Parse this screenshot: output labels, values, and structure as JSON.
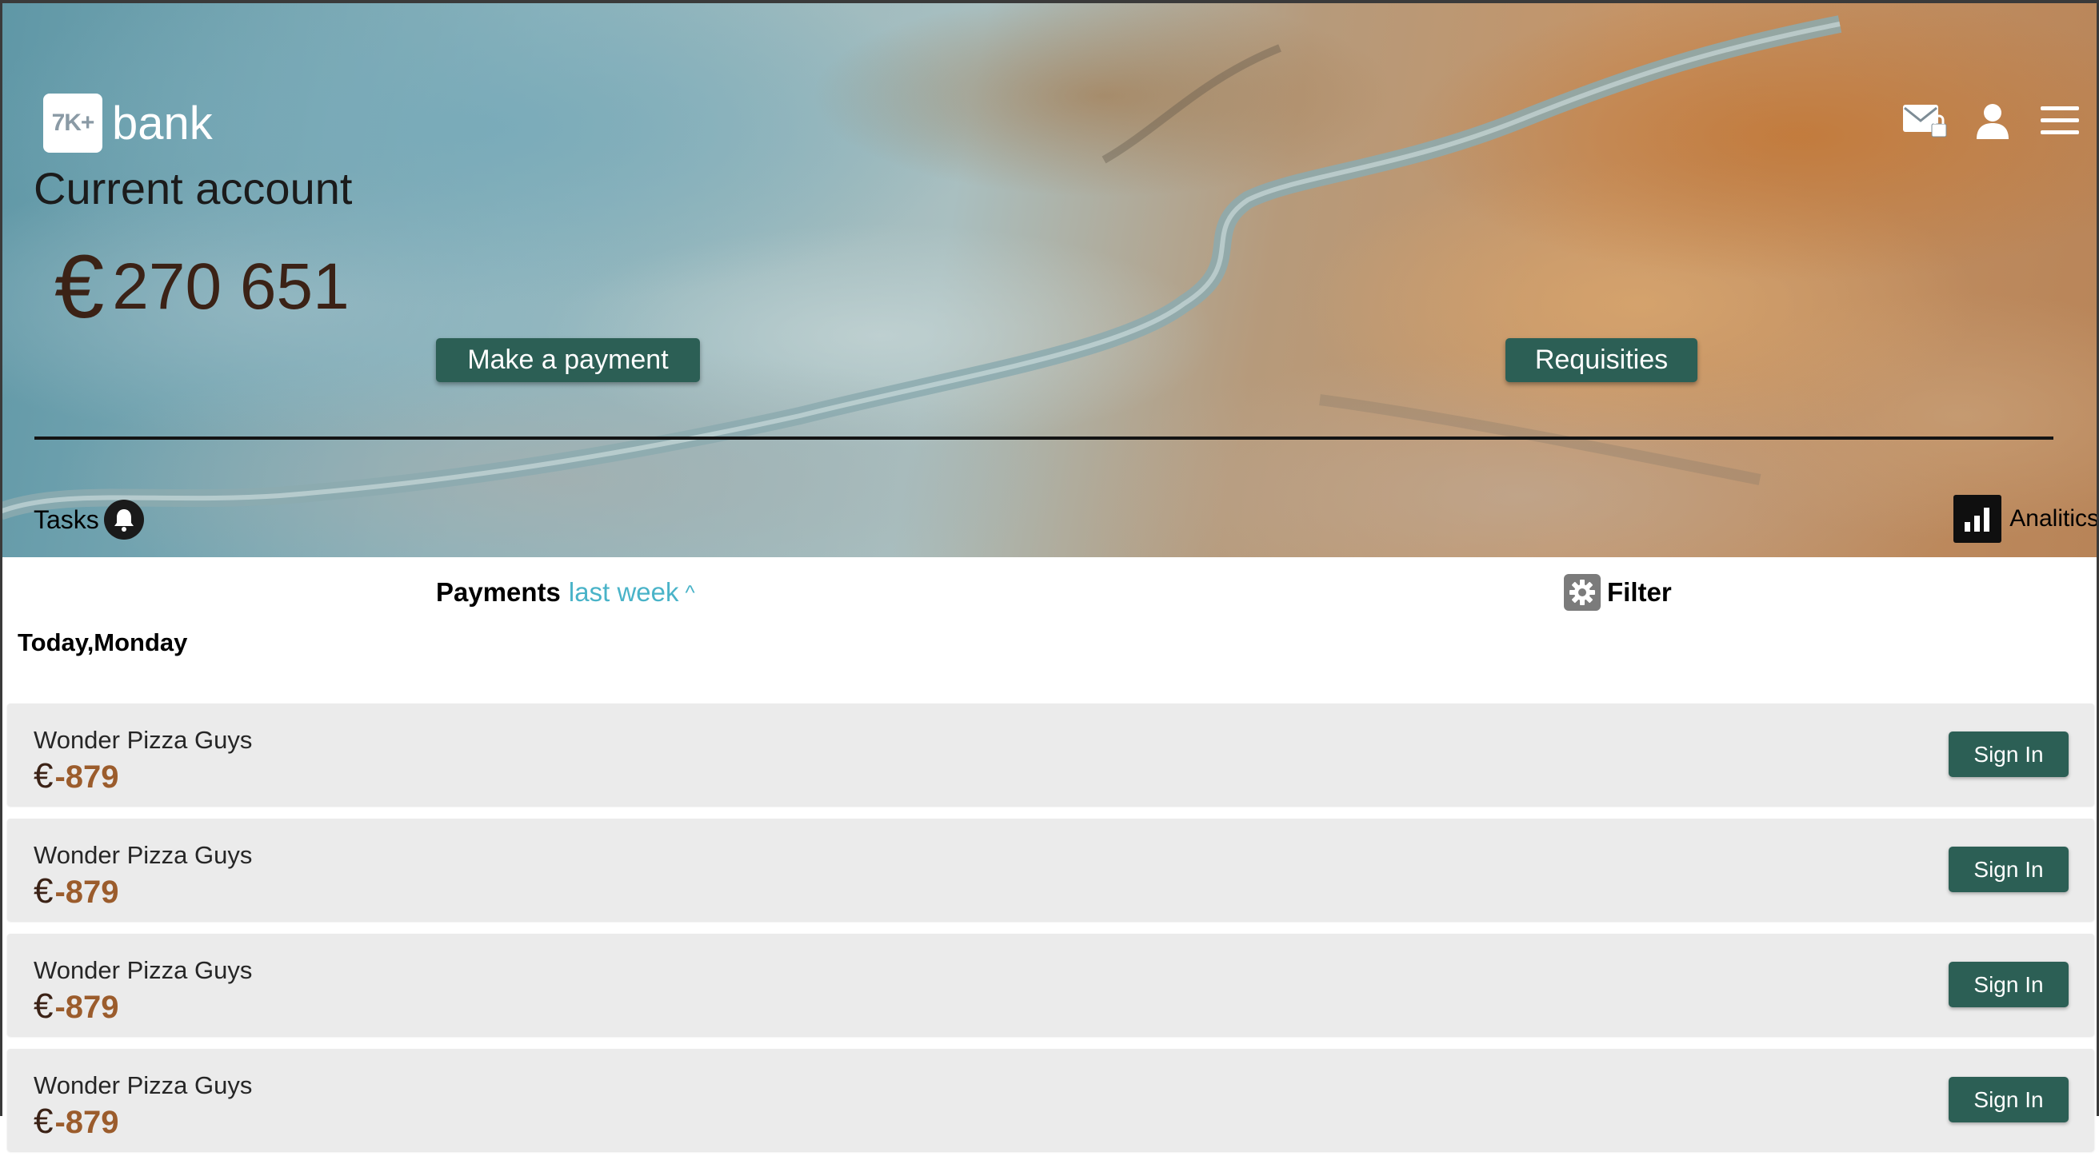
{
  "brand": {
    "logo_badge": "7K+",
    "logo_text": "bank"
  },
  "header_icons": [
    "mail-lock-icon",
    "user-icon",
    "menu-icon"
  ],
  "account": {
    "title": "Current account",
    "currency_symbol": "€",
    "balance": "270 651"
  },
  "actions": {
    "make_payment": "Make a payment",
    "requisities": "Requisities"
  },
  "tasks": {
    "label": "Tasks"
  },
  "analitics": {
    "label": "Analitics"
  },
  "payments": {
    "label": "Payments",
    "period": "last week",
    "caret": "^",
    "filter_label": "Filter",
    "day_label": "Today,Monday",
    "items": [
      {
        "merchant": "Wonder Pizza Guys",
        "currency": "€",
        "amount": "-879",
        "button": "Sign In"
      },
      {
        "merchant": "Wonder Pizza Guys",
        "currency": "€",
        "amount": "-879",
        "button": "Sign In"
      },
      {
        "merchant": "Wonder Pizza Guys",
        "currency": "€",
        "amount": "-879",
        "button": "Sign In"
      },
      {
        "merchant": "Wonder Pizza Guys",
        "currency": "€",
        "amount": "-879",
        "button": "Sign In"
      }
    ]
  },
  "colors": {
    "primary_button": "#2c5f55",
    "link_accent": "#49b3c8",
    "amount_negative": "#9b5c2c",
    "balance_text": "#3b2216"
  }
}
